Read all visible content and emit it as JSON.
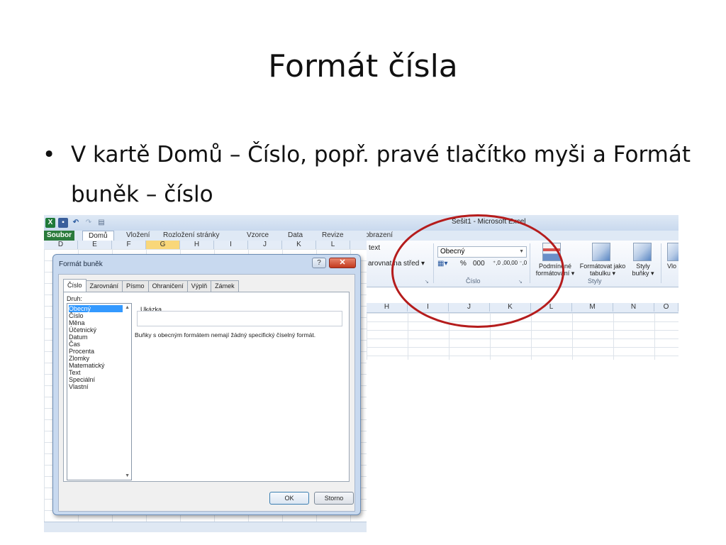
{
  "slide": {
    "title": "Formát čísla",
    "bullet": "•",
    "bullet_text": "V kartě Domů – Číslo, popř. pravé tlačítko myši a Formát buněk – číslo"
  },
  "excel": {
    "window_title": "Sešit1 - Microsoft Excel",
    "ribbon_tabs": [
      "Soubor",
      "Domů",
      "Vložení",
      "Rozložení stránky",
      "Vzorce",
      "Data",
      "Revize",
      "Zobrazení"
    ],
    "columns_left": [
      "D",
      "E",
      "F",
      "G",
      "H",
      "I",
      "J",
      "K",
      "L"
    ],
    "columns_right": [
      "H",
      "I",
      "J",
      "K",
      "L",
      "M",
      "N",
      "O"
    ],
    "alignment_group": {
      "wrap_text_label": "text",
      "merge_center_label": "arovnat na střed ▾"
    },
    "number_group": {
      "format_value": "Obecný",
      "percent": "%",
      "thousands": "000",
      "increase_decimal": "⁺,0 ,00",
      "decrease_decimal": ",00 ⁻,0",
      "group_label": "Číslo"
    },
    "styles_group": {
      "conditional_formatting": "Podmíněné formátování ▾",
      "format_as_table": "Formátovat jako tabulku ▾",
      "cell_styles": "Styly buňky ▾",
      "group_label": "Styly",
      "insert_partial": "Vlo"
    },
    "colors": {
      "file_tab": "#2b7b3c",
      "highlight": "#b51c1c",
      "selected": "#3399ff"
    }
  },
  "dialog": {
    "title": "Formát buněk",
    "help": "?",
    "close": "✕",
    "tabs": [
      "Číslo",
      "Zarovnání",
      "Písmo",
      "Ohraničení",
      "Výplň",
      "Zámek"
    ],
    "category_label": "Druh:",
    "categories": [
      "Obecný",
      "Číslo",
      "Měna",
      "Účetnický",
      "Datum",
      "Čas",
      "Procenta",
      "Zlomky",
      "Matematický",
      "Text",
      "Speciální",
      "Vlastní"
    ],
    "selected_category": "Obecný",
    "sample_label": "Ukázka",
    "description": "Buňky s obecným formátem nemají žádný specifický číselný formát.",
    "ok": "OK",
    "cancel": "Storno"
  }
}
